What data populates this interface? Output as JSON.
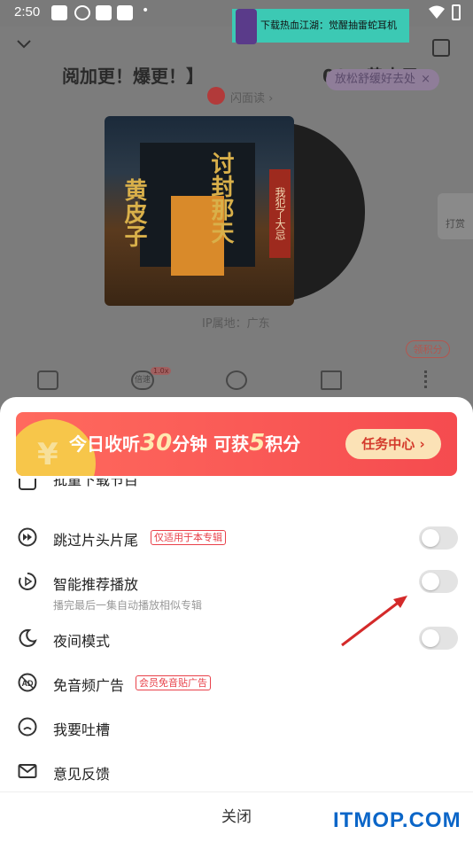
{
  "status_bar": {
    "time": "2:50",
    "dot": "•"
  },
  "top_ad": {
    "text": "下载热血江湖：觉醒抽雷蛇耳机"
  },
  "player": {
    "album_title": "阅加更！爆更！】",
    "episode_title": "001 黄皮子",
    "relax_pill": "放松舒缓好去处",
    "relax_close": "×",
    "flash_read": "闪面读 ›",
    "cover_title_a": "讨封那天",
    "cover_title_b": "黄皮子",
    "cover_seal": "我犯了大忌",
    "ip_location": "IP属地：广东",
    "earn_points": "领积分",
    "tip_label": "打赏",
    "speed_label": "倍速",
    "speed_badge": "1.0x"
  },
  "sheet": {
    "banner": {
      "prefix": "今日收听",
      "minutes": "30",
      "mid": "分钟  可获",
      "points": "5",
      "suffix": "积分",
      "task_button": "任务中心 ›"
    },
    "items": [
      {
        "label": "批量下载节目",
        "tag": "",
        "sub": "",
        "toggle": null,
        "icon": "download-icon"
      },
      {
        "label": "跳过片头片尾",
        "tag": "仅适用于本专辑",
        "sub": "",
        "toggle": false,
        "icon": "skip-icon"
      },
      {
        "label": "智能推荐播放",
        "tag": "",
        "sub": "播完最后一集自动播放相似专辑",
        "toggle": false,
        "icon": "smart-play-icon"
      },
      {
        "label": "夜间模式",
        "tag": "",
        "sub": "",
        "toggle": false,
        "icon": "moon-icon"
      },
      {
        "label": "免音频广告",
        "tag": "会员免音贴广告",
        "sub": "",
        "toggle": null,
        "icon": "no-ads-icon"
      },
      {
        "label": "我要吐槽",
        "tag": "",
        "sub": "",
        "toggle": null,
        "icon": "comment-icon"
      },
      {
        "label": "意见反馈",
        "tag": "",
        "sub": "",
        "toggle": null,
        "icon": "mail-icon"
      }
    ],
    "close": "关闭"
  },
  "watermark": "ITMOP.COM"
}
